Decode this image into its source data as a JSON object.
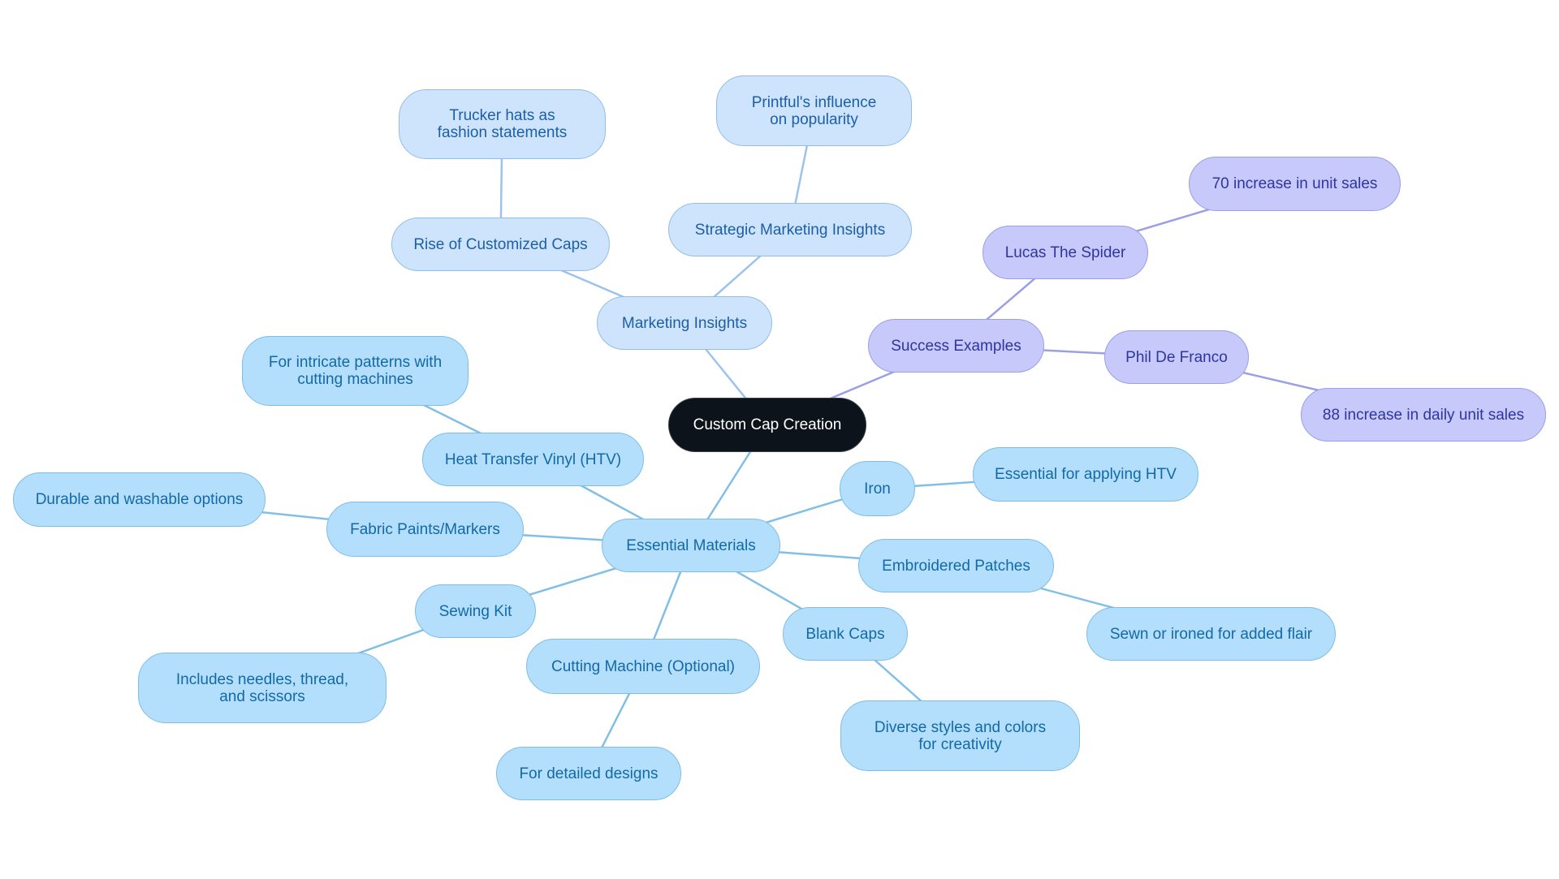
{
  "diagram": {
    "type": "mind-map",
    "title": "Custom Cap Creation",
    "colors": {
      "root_fill": "#0d131a",
      "root_text": "#ffffff",
      "marketing_fill": "#cde4fc",
      "marketing_text": "#1c5fa8",
      "marketing_edge": "#9cc3ec",
      "materials_fill": "#b3dffc",
      "materials_text": "#1369a8",
      "materials_edge": "#82bfe6",
      "success_fill": "#c7c9fb",
      "success_text": "#2e35a0",
      "success_edge": "#9b9fe3"
    },
    "nodes": {
      "root": "Custom Cap Creation",
      "marketing": "Marketing Insights",
      "rise": "Rise of Customized Caps",
      "trucker": "Trucker hats as fashion statements",
      "strategic": "Strategic Marketing Insights",
      "printful": "Printful's influence on popularity",
      "success": "Success Examples",
      "lucas": "Lucas The Spider",
      "lucas_stat": "70 increase in unit sales",
      "phil": "Phil De Franco",
      "phil_stat": "88 increase in daily unit sales",
      "materials": "Essential Materials",
      "htv": "Heat Transfer Vinyl (HTV)",
      "htv_note": "For intricate patterns with cutting machines",
      "paints": "Fabric Paints/Markers",
      "paints_note": "Durable and washable options",
      "sewing": "Sewing Kit",
      "sewing_note": "Includes needles, thread, and scissors",
      "cutting": "Cutting Machine (Optional)",
      "cutting_note": "For detailed designs",
      "blank": "Blank Caps",
      "blank_note": "Diverse styles and colors for creativity",
      "iron": "Iron",
      "iron_note": "Essential for applying HTV",
      "patches": "Embroidered Patches",
      "patches_note": "Sewn or ironed for added flair"
    },
    "edges": [
      [
        "root",
        "marketing"
      ],
      [
        "marketing",
        "rise"
      ],
      [
        "rise",
        "trucker"
      ],
      [
        "marketing",
        "strategic"
      ],
      [
        "strategic",
        "printful"
      ],
      [
        "root",
        "success"
      ],
      [
        "success",
        "lucas"
      ],
      [
        "lucas",
        "lucas_stat"
      ],
      [
        "success",
        "phil"
      ],
      [
        "phil",
        "phil_stat"
      ],
      [
        "root",
        "materials"
      ],
      [
        "materials",
        "htv"
      ],
      [
        "htv",
        "htv_note"
      ],
      [
        "materials",
        "paints"
      ],
      [
        "paints",
        "paints_note"
      ],
      [
        "materials",
        "sewing"
      ],
      [
        "sewing",
        "sewing_note"
      ],
      [
        "materials",
        "cutting"
      ],
      [
        "cutting",
        "cutting_note"
      ],
      [
        "materials",
        "blank"
      ],
      [
        "blank",
        "blank_note"
      ],
      [
        "materials",
        "iron"
      ],
      [
        "iron",
        "iron_note"
      ],
      [
        "materials",
        "patches"
      ],
      [
        "patches",
        "patches_note"
      ]
    ]
  }
}
